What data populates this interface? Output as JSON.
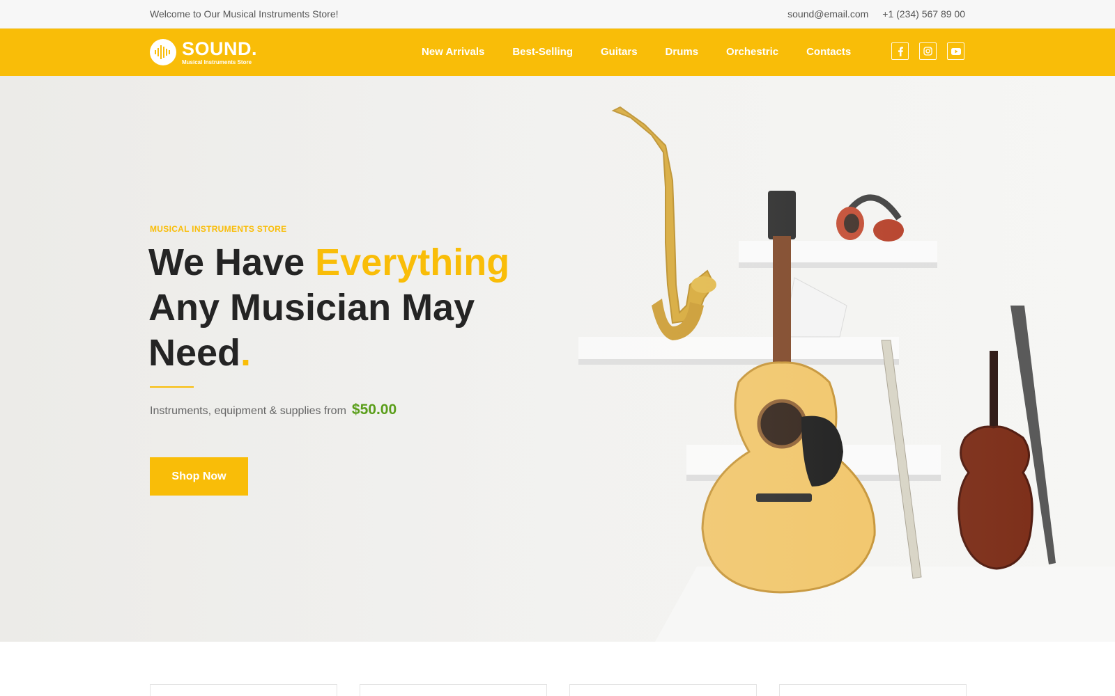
{
  "topbar": {
    "welcome": "Welcome to Our Musical Instruments Store!",
    "email": "sound@email.com",
    "phone": "+1 (234) 567 89 00"
  },
  "brand": {
    "name": "SOUND.",
    "tagline": "Musical Instruments Store",
    "accent_color": "#f9bd08"
  },
  "nav": {
    "items": [
      "New Arrivals",
      "Best-Selling",
      "Guitars",
      "Drums",
      "Orchestric",
      "Contacts"
    ]
  },
  "socials": {
    "icons": [
      "facebook-icon",
      "instagram-icon",
      "youtube-icon"
    ]
  },
  "hero": {
    "eyebrow": "MUSICAL INSTRUMENTS STORE",
    "headline_part1": "We Have ",
    "headline_accent": "Everything",
    "headline_part2": "Any Musician May Need",
    "headline_dot": ".",
    "subline": "Instruments, equipment & supplies from",
    "price": "$50.00",
    "price_color": "#5a9e1a",
    "cta_label": "Shop Now"
  }
}
